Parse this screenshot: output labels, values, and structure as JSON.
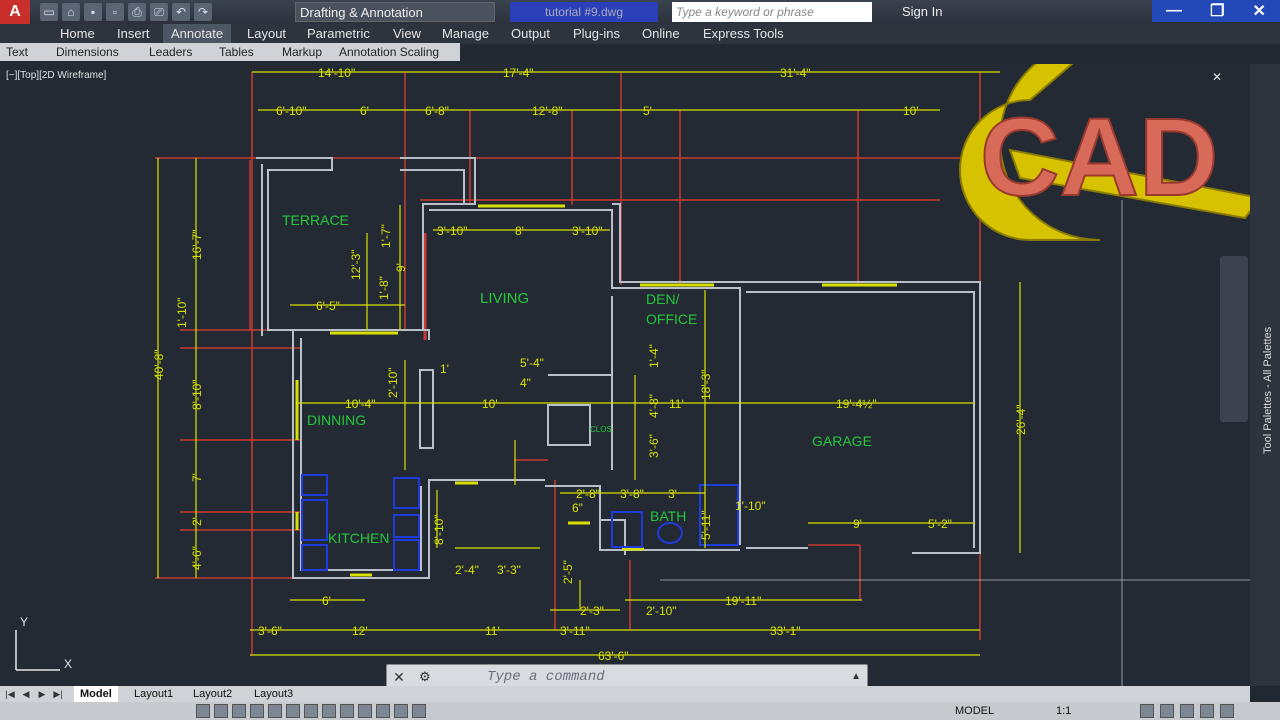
{
  "app": {
    "logo": "A",
    "workspace": "Drafting & Annotation",
    "filename": "tutorial #9.dwg",
    "search_placeholder": "Type a keyword or phrase",
    "signin": "Sign In",
    "help": "?"
  },
  "ribbon_tabs": [
    "Home",
    "Insert",
    "Annotate",
    "Layout",
    "Parametric",
    "View",
    "Manage",
    "Output",
    "Plug-ins",
    "Online",
    "Express Tools"
  ],
  "panels": [
    "Text",
    "Dimensions",
    "Leaders",
    "Tables",
    "Markup",
    "Annotation Scaling"
  ],
  "viewport_label": "[−][Top][2D Wireframe]",
  "rooms": [
    "TERRACE",
    "LIVING",
    "DEN/",
    "OFFICE",
    "DINNING",
    "KITCHEN",
    "GARAGE",
    "BATH",
    "CLOS."
  ],
  "dims": {
    "top1": [
      "14'-10\"",
      "17'-4\"",
      "31'-4\""
    ],
    "top2": [
      "6'-10\"",
      "6'",
      "6'-8\"",
      "12'-8\"",
      "5'",
      "10'"
    ],
    "left": [
      "40'-8\"",
      "16'-7\"",
      "1'-10\"",
      "8'-10\"",
      "7'",
      "2'",
      "4'-6\""
    ],
    "right": "26'-4\"",
    "inner": [
      "3'-10\"",
      "8'",
      "3'-10\"",
      "1'-7\"",
      "9'",
      "12'-3\"",
      "1'-8\"",
      "6'-5\"",
      "10'-4\"",
      "10'",
      "11'",
      "19'-4½\"",
      "18'-3\"",
      "5'-4\"",
      "4\"",
      "2'-10\"",
      "1'",
      "3'-6\"",
      "4'-8\"",
      "1'-4\"",
      "9'",
      "5'-2\"",
      "6'",
      "2'-4\"",
      "3'-3\"",
      "2'-5\"",
      "2'-3\"",
      "2'-10\"",
      "19'-11\"",
      "3'-8\"",
      "3'",
      "1'-10\"",
      "2'-8\"",
      "6\"",
      "5'-11\"",
      "8'-10\""
    ],
    "bottom1": [
      "3'-6\"",
      "12'",
      "11'",
      "3'-11\"",
      "33'-1\""
    ],
    "bottom2": "63'-6\""
  },
  "logo_text": "CAD",
  "command_placeholder": "Type a command",
  "layout_tabs": [
    "Model",
    "Layout1",
    "Layout2",
    "Layout3"
  ],
  "status": {
    "model": "MODEL",
    "scale": "1:1"
  },
  "palette_label": "Tool Palettes - All Palettes",
  "colors": {
    "dim": "#d8e000",
    "wall": "#b9c0c9",
    "construct": "#c83a33",
    "text": "#23c83b",
    "furniture": "#1f3bd9",
    "bg": "#232a33"
  }
}
